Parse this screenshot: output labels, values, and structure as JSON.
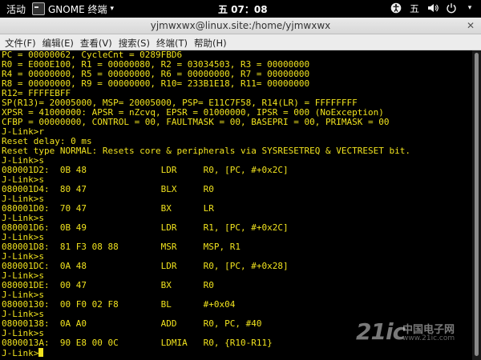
{
  "topbar": {
    "activities": "活动",
    "app_name": "GNOME 终端",
    "clock": "五 07：08",
    "tray_icons": [
      "accessibility-icon",
      "input-method-icon",
      "volume-icon",
      "power-icon"
    ],
    "input_method": "五"
  },
  "window": {
    "title": "yjmwxwx@linux.site:/home/yjmwxwx",
    "menu": [
      "文件(F)",
      "编辑(E)",
      "查看(V)",
      "搜索(S)",
      "终端(T)",
      "帮助(H)"
    ]
  },
  "terminal": {
    "text_color": "#f0e21e",
    "background": "#000000",
    "lines": [
      "PC = 00000062, CycleCnt = 0289FBD6",
      "R0 = E000E100, R1 = 00000080, R2 = 03034503, R3 = 00000000",
      "R4 = 00000000, R5 = 00000000, R6 = 00000000, R7 = 00000000",
      "R8 = 00000000, R9 = 00000000, R10= 233B1E18, R11= 00000000",
      "R12= FFFFEBFF",
      "SP(R13)= 20005000, MSP= 20005000, PSP= E11C7F58, R14(LR) = FFFFFFFF",
      "XPSR = 41000000: APSR = nZcvq, EPSR = 01000000, IPSR = 000 (NoException)",
      "CFBP = 00000000, CONTROL = 00, FAULTMASK = 00, BASEPRI = 00, PRIMASK = 00",
      "J-Link>r",
      "Reset delay: 0 ms",
      "Reset type NORMAL: Resets core & peripherals via SYSRESETREQ & VECTRESET bit.",
      "J-Link>s",
      "080001D2:  0B 48              LDR     R0, [PC, #+0x2C]",
      "J-Link>s",
      "080001D4:  80 47              BLX     R0",
      "J-Link>s",
      "080001D0:  70 47              BX      LR",
      "J-Link>s",
      "080001D6:  0B 49              LDR     R1, [PC, #+0x2C]",
      "J-Link>s",
      "080001D8:  81 F3 08 88        MSR     MSP, R1",
      "J-Link>s",
      "080001DC:  0A 48              LDR     R0, [PC, #+0x28]",
      "J-Link>s",
      "080001DE:  00 47              BX      R0",
      "J-Link>s",
      "08000130:  00 F0 02 F8        BL      #+0x04",
      "J-Link>s",
      "08000138:  0A A0              ADD     R0, PC, #40",
      "J-Link>s",
      "0800013A:  90 E8 00 0C        LDMIA   R0, {R10-R11}",
      "J-Link>"
    ]
  },
  "watermark": {
    "main": "21ic",
    "cn": "中国电子网",
    "url": "www.21ic.com"
  }
}
